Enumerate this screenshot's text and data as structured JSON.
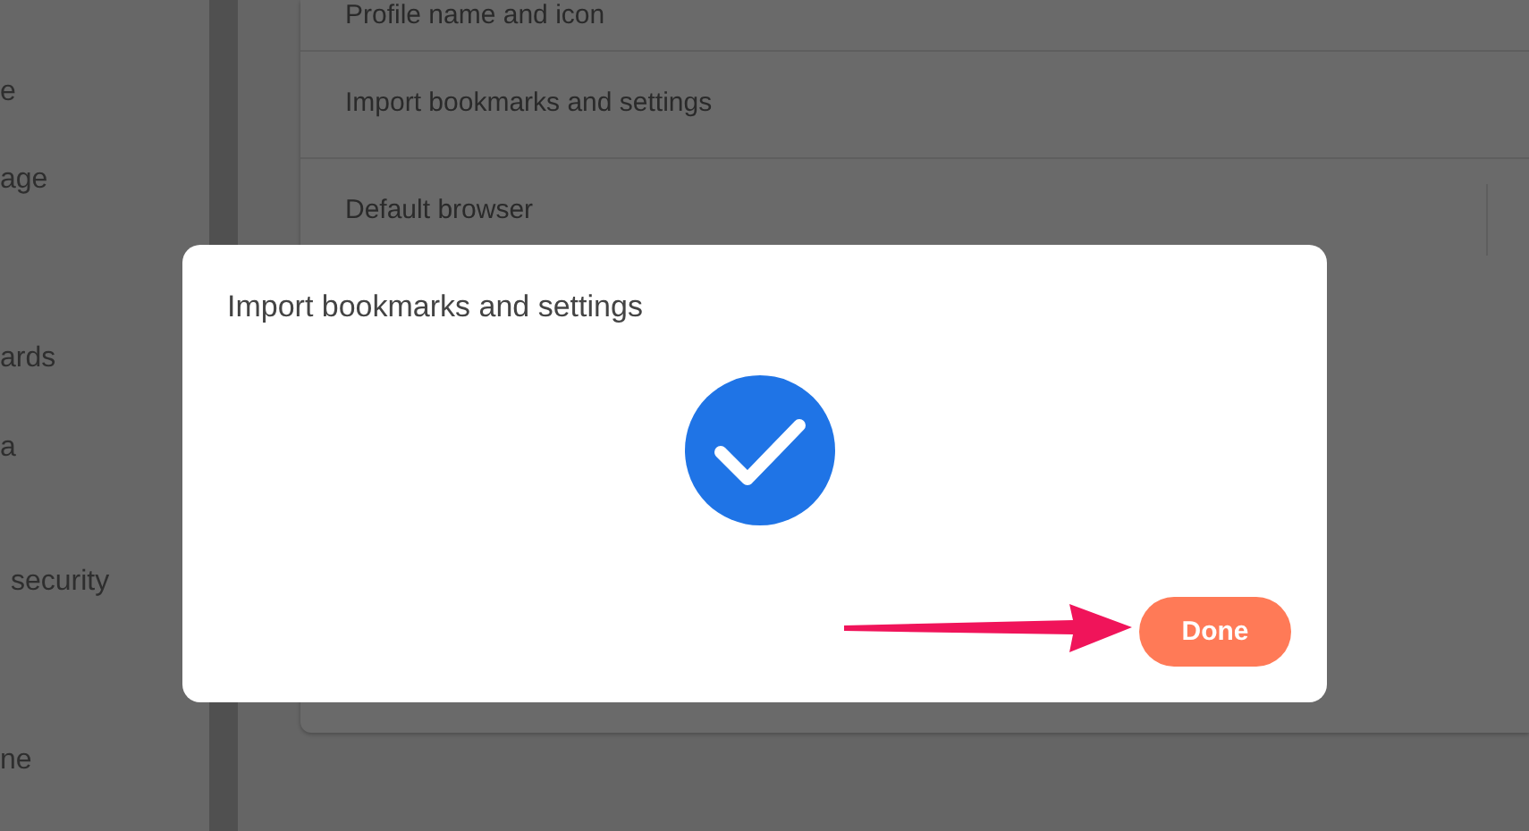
{
  "sidebar": {
    "items": [
      {
        "label": "e"
      },
      {
        "label": "age"
      },
      {
        "label": "ards"
      },
      {
        "label": "a"
      },
      {
        "label": "security"
      },
      {
        "label": "ne"
      }
    ]
  },
  "settings": {
    "rows": [
      {
        "label": "Profile name and icon"
      },
      {
        "label": "Import bookmarks and settings"
      },
      {
        "label": "Default browser"
      }
    ]
  },
  "dialog": {
    "title": "Import bookmarks and settings",
    "button": "Done"
  }
}
